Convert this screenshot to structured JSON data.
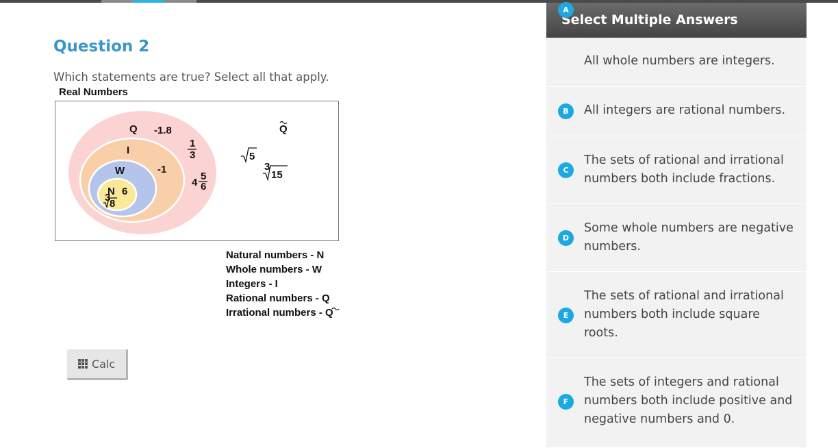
{
  "question": {
    "title": "Question 2",
    "prompt": "Which statements are true? Select all that apply."
  },
  "figure": {
    "title": "Real Numbers",
    "set_labels": {
      "rational": "Q",
      "integers": "I",
      "whole": "W",
      "natural": "N",
      "irrational": "Q"
    },
    "values": {
      "neg_1_8": "-1.8",
      "third_num": "1",
      "third_den": "3",
      "neg_1": "-1",
      "mixed_whole": "4",
      "mixed_num": "5",
      "mixed_den": "6",
      "six": "6",
      "cube_root_8_index": "3",
      "cube_root_8_radicand": "8",
      "sqrt_5": "5",
      "cube_root_15_index": "3",
      "cube_root_15_radicand": "15"
    },
    "colors": {
      "rational": "#fcd3d3",
      "integers": "#f9cfa9",
      "whole": "#b4c4ea",
      "natural": "#fbe99a"
    }
  },
  "legend": [
    "Natural numbers - N",
    "Whole numbers - W",
    "Integers - I",
    "Rational numbers - Q",
    "Irrational numbers - Q"
  ],
  "calc": {
    "label": "Calc",
    "icon": "grid-icon"
  },
  "answers_panel": {
    "header": "Select Multiple Answers",
    "accent": "#1ca8e0",
    "options": [
      {
        "letter": "A",
        "text": "All whole numbers are integers."
      },
      {
        "letter": "B",
        "text": "All integers are rational numbers."
      },
      {
        "letter": "C",
        "text": "The sets of rational and irrational numbers both include fractions."
      },
      {
        "letter": "D",
        "text": "Some whole numbers are negative numbers."
      },
      {
        "letter": "E",
        "text": "The sets of rational and irrational numbers both include square roots."
      },
      {
        "letter": "F",
        "text": "The sets of integers and rational numbers both include positive and negative numbers and 0."
      }
    ]
  }
}
